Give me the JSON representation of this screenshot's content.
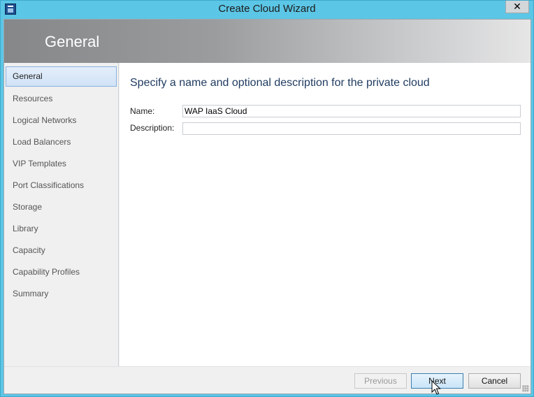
{
  "window": {
    "title": "Create Cloud Wizard",
    "close_label": "✕"
  },
  "header": {
    "title": "General"
  },
  "sidebar": {
    "items": [
      {
        "label": "General",
        "active": true
      },
      {
        "label": "Resources"
      },
      {
        "label": "Logical Networks"
      },
      {
        "label": "Load Balancers"
      },
      {
        "label": "VIP Templates"
      },
      {
        "label": "Port Classifications"
      },
      {
        "label": "Storage"
      },
      {
        "label": "Library"
      },
      {
        "label": "Capacity"
      },
      {
        "label": "Capability Profiles"
      },
      {
        "label": "Summary"
      }
    ]
  },
  "main": {
    "heading": "Specify a name and optional description for the private cloud",
    "name_label": "Name:",
    "name_value": "WAP IaaS Cloud",
    "description_label": "Description:",
    "description_value": ""
  },
  "footer": {
    "previous_label": "Previous",
    "next_label": "Next",
    "cancel_label": "Cancel"
  },
  "colors": {
    "frame": "#5cc6e6",
    "accent": "#87b1e0",
    "heading": "#1f3a5f"
  }
}
